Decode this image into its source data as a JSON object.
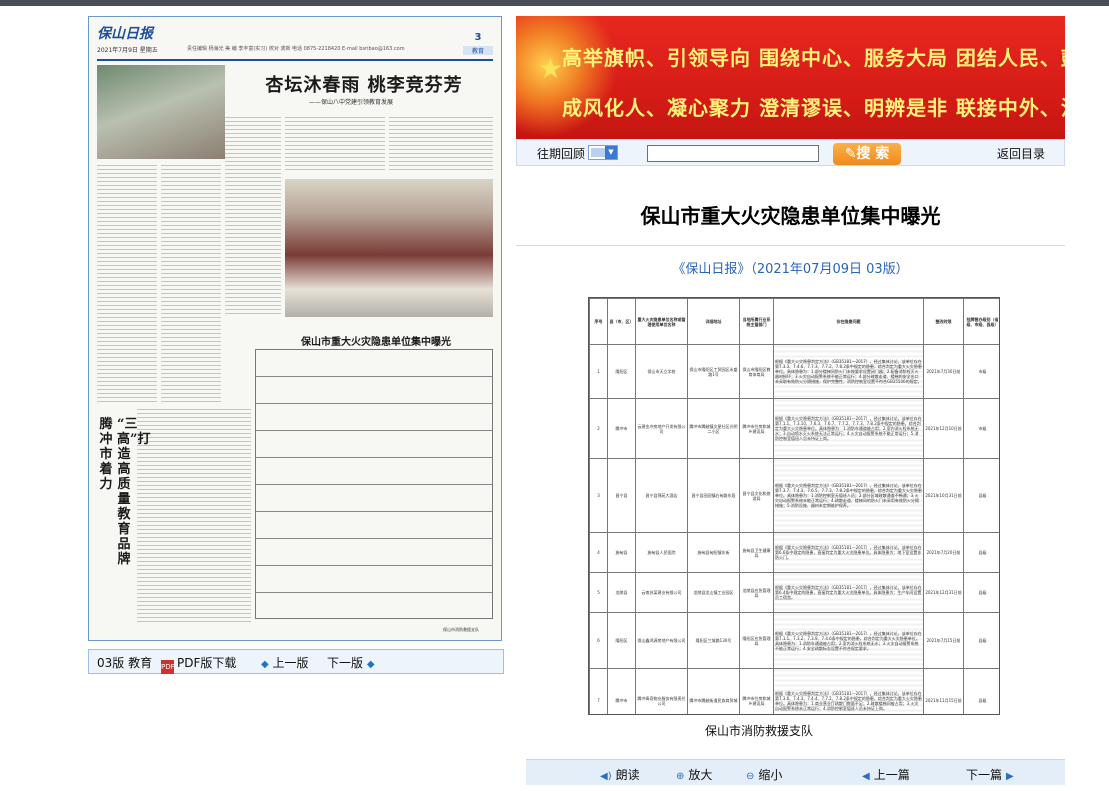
{
  "newspaper": {
    "logo": "保山日报",
    "date": "2021年7月9日 星期五",
    "info": "责任编辑 杨海光  美 编 李丰富(实习) 校对 龚新  电话 0875-2218420  E-mail bsribao@163.com",
    "page_number": "3",
    "section": "教育",
    "headline": "杏坛沐春雨  桃李竞芬芳",
    "subhead": "——保山八中党建引领教育发展",
    "vertical_title_1": "腾冲市着力",
    "vertical_title_2": "“三高”打造高质量教育品牌",
    "mini_table_title": "保山市重大火灾隐患单位集中曝光",
    "footer": "保山市消防救援支队"
  },
  "left_toolbar": {
    "edition": "03版 教育",
    "pdf": "PDF版下载",
    "prev": "上一版",
    "next": "下一版"
  },
  "banner": {
    "line1": "高举旗帜、引领导向 围绕中心、服务大局 团结人民、鼓舞士气",
    "line2": "成风化人、凝心聚力 澄清谬误、明辨是非 联接中外、沟通世界"
  },
  "search": {
    "past_label": "往期回顾",
    "search_button": "搜 索",
    "back_to_toc": "返回目录"
  },
  "article": {
    "title": "保山市重大火灾隐患单位集中曝光",
    "source": "《保山日报》（2021年07月09日 03版）",
    "caption": "保山市消防救援支队"
  },
  "table": {
    "headers": [
      "序号",
      "县（市、区）",
      "重大火灾隐患单位名称或管理使用单位名称",
      "详细地址",
      "当地所属行业系统主管部门",
      "存在隐患问题",
      "整改时限",
      "挂牌督办级别（省级、市级、县级）"
    ],
    "rows": [
      [
        "1",
        "隆阳区",
        "保山市天立学校",
        "保山市隆阳区工贸园区永盛路1号",
        "保山市隆阳区教育体育局",
        "根据《重大火灾隐患判定方法》（GB35181—2017），经过集体讨论，该单位存在第7.3.3、7.4.6、7.7.3、7.7.2、7.8.2条中规定的隐患，综合判定为重大火灾隐患单位。具体隐患为：1.部分楼梯间防火门未按要求设置闭门器；2.配备消防栓灭火器材损坏；3.火灾自动报警系统不能正常运行；4.部分疏散走道、楼梯的安全出口未采取有效防火分隔措施，保护完整性，消防控制室设置不符合GB25506的规定。",
        "2021年7月30日前",
        "市级"
      ],
      [
        "2",
        "腾冲市",
        "云建金冲房地产开发有限公司",
        "腾冲市腾越镇文星社区光明二小区",
        "腾冲市住房和城乡建设局",
        "根据《重大火灾隐患判定方法》（GB35181—2017），经过集体讨论，该单位存在第7.1.1、7.3.10、7.6.3、7.6.7、7.7.2、7.7.3、7.8.2条中规定的隐患，综合判定为重大火灾隐患单位。具体隐患为：1.消防车通道被占用；2.室内消火栓系统无水；3.自动喷水灭火系统无法正常运行；4.火灾自动报警系统不能正常运行；5.消防控制室值班人员未持证上岗。",
        "2021年12月10日前",
        "市级"
      ],
      [
        "3",
        "昌宁县",
        "昌宁县锦苑大酒店",
        "昌宁县田园镇右甸路东段",
        "昌宁县文化和旅游局",
        "根据《重大火灾隐患判定方法》（GB35181—2017），经过集体讨论，该单位存在第7.3.7、7.4.3、7.6.5、7.7.3、7.8.2条中规定的隐患，综合判定为重大火灾隐患单位。具体隐患为：1.消防控制室无值班人员；2.部分区域疏散通道不畅通；3.火灾自动报警系统未能正常运行；4.疏散走道、楼梯间的防火门未采用有效防火分隔措施；5.消防设施、器材未定期维护保养。",
        "2021年10月31日前",
        "县级"
      ],
      [
        "4",
        "施甸县",
        "施甸县人民医院",
        "施甸县甸阳镇东街",
        "施甸县卫生健康局",
        "根据《重大火灾隐患判定方法》（GB35181—2017），经过集体讨论，该单位存在第6.6条中规定的隐患，直接判定为重大火灾隐患单位。具体隐患为：地下室设置非防火门。",
        "2021年7月20日前",
        "县级"
      ],
      [
        "5",
        "龙陵县",
        "云南苏某建业有限公司",
        "龙陵县龙山镇工业园区",
        "龙陵县应急管理局",
        "根据《重大火灾隐患判定方法》（GB35181—2017），经过集体讨论，该单位存在第6.4条中规定的隐患，直接判定为重大火灾隐患单位。具体隐患为：生产车间设置员工宿舍。",
        "2021年12月31日前",
        "县级"
      ],
      [
        "6",
        "隆阳区",
        "保山鑫鸿源房地产有限公司",
        "隆阳区兰城路130号",
        "隆阳区应急管理局",
        "根据《重大火灾隐患判定方法》（GB35181—2017），经过集体讨论，该单位存在第7.1.1、7.3.2、7.3.9、7.4.6条中规定的隐患，综合判定为重大火灾隐患单位。具体隐患为：1.消防车通道被占用；2.室内消火栓系统无水；3.火灾自动报警系统不能正常运行；4.安全疏散标志设置不符合规定要求。",
        "2021年7月15日前",
        "县级"
      ],
      [
        "7",
        "腾冲市",
        "腾冲青奇物业服务有限责任公司",
        "腾冲市腾越街道民族商贸城",
        "腾冲市住房和城乡建设局",
        "根据《重大火灾隐患判定方法》（GB35181—2017），经过集体讨论，该单位存在第7.3.6、7.4.3、7.4.4、7.7.2、7.8.2条中规定的隐患，综合判定为重大火灾隐患单位。具体隐患为：1.商业营业厅疏散门数量不足；2.疏散楼梯间被占用；3.火灾自动报警系统未正常运行；4.消防控制室值班人员未持证上岗。",
        "2021年11月15日前",
        "县级"
      ]
    ]
  },
  "bottom_bar": {
    "read_aloud": "朗读",
    "zoom_in": "放大",
    "zoom_out": "缩小",
    "prev_article": "上一篇",
    "next_article": "下一篇"
  },
  "colors": {
    "accent_blue": "#2a64b8",
    "banner_red": "#d71c17",
    "banner_text": "#fff37a",
    "search_orange": "#f08a1c"
  }
}
